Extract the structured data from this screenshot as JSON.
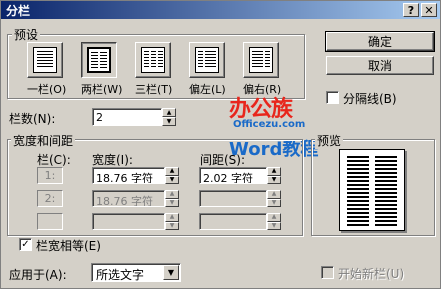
{
  "window": {
    "title": "分栏",
    "help_label": "?",
    "close_label": "✕"
  },
  "presets": {
    "group_label": "预设",
    "items": [
      {
        "label": "一栏(O)",
        "selected": false
      },
      {
        "label": "两栏(W)",
        "selected": true
      },
      {
        "label": "三栏(T)",
        "selected": false
      },
      {
        "label": "偏左(L)",
        "selected": false
      },
      {
        "label": "偏右(R)",
        "selected": false
      }
    ]
  },
  "buttons": {
    "ok": "确定",
    "cancel": "取消"
  },
  "line_between": {
    "label": "分隔线(B)",
    "checked": false
  },
  "column_count": {
    "label": "栏数(N):",
    "value": "2"
  },
  "width_spacing": {
    "group_label": "宽度和间距",
    "col_header": "栏(C):",
    "width_header": "宽度(I):",
    "spacing_header": "间距(S):",
    "rows": [
      {
        "num": "1:",
        "width": "18.76 字符",
        "spacing": "2.02 字符",
        "enabled": true
      },
      {
        "num": "2:",
        "width": "18.76 字符",
        "spacing": "",
        "enabled": false
      },
      {
        "num": "",
        "width": "",
        "spacing": "",
        "enabled": false
      }
    ]
  },
  "equal_width": {
    "label": "栏宽相等(E)",
    "checked": true
  },
  "preview": {
    "label": "预览"
  },
  "apply_to": {
    "label": "应用于(A):",
    "value": "所选文字"
  },
  "start_new_column": {
    "label": "开始新栏(U)",
    "checked": false
  },
  "watermark": {
    "line1": "办公族",
    "line2": "Officezu.com",
    "line3": "Word教程"
  },
  "colors": {
    "title_start": "#0a246a",
    "title_end": "#a6caf0",
    "face": "#d4d0c8",
    "logo_red": "#e8261c",
    "logo_blue": "#1a6ac8"
  }
}
